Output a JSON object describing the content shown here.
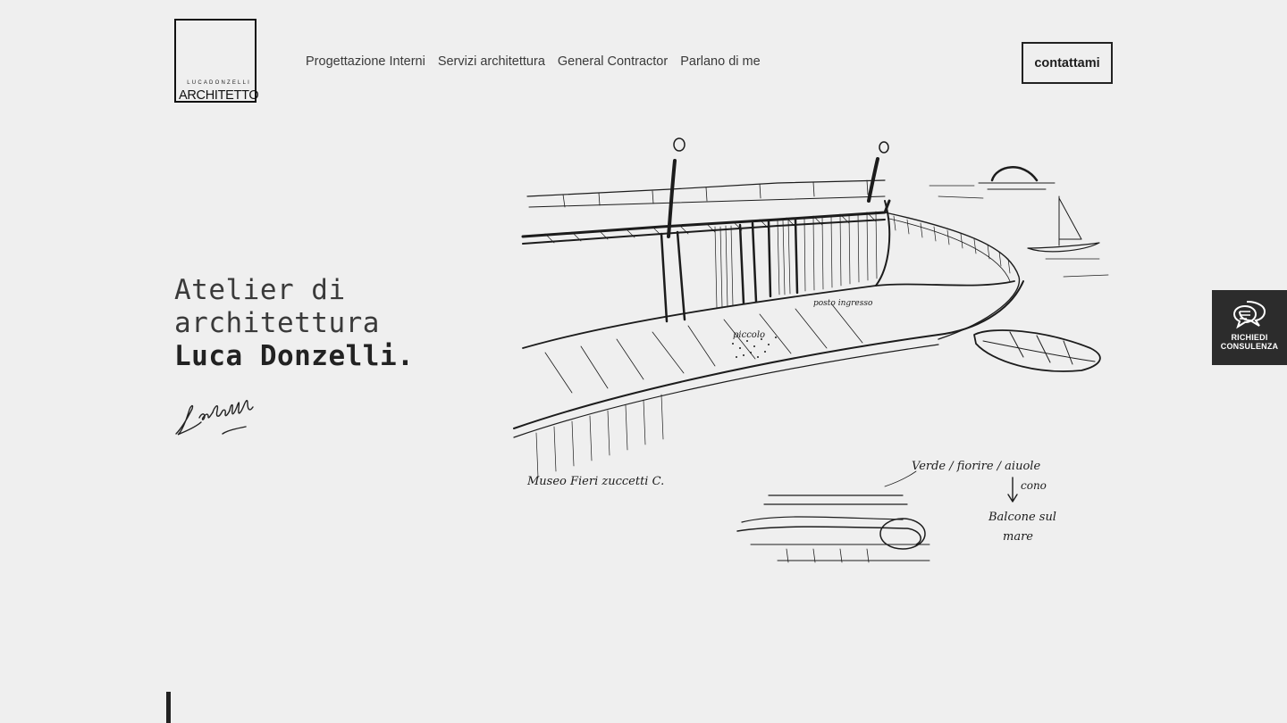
{
  "logo": {
    "small_text": "LUCADONZELLI",
    "big_text": "ARCHITETTO"
  },
  "nav": {
    "items": [
      {
        "label": "Progettazione Interni"
      },
      {
        "label": "Servizi architettura"
      },
      {
        "label": "General Contractor"
      },
      {
        "label": "Parlano di me"
      }
    ]
  },
  "cta": {
    "label": "contattami"
  },
  "hero": {
    "line1": "Atelier di",
    "line2": "architettura",
    "line3": "Luca Donzelli."
  },
  "sketch": {
    "annotation_left": "Museo Fieri  zuccetti C.",
    "annotation_right_1": "Verde / fiorire / aiuole",
    "annotation_right_2": "cono",
    "annotation_right_3": "Balcone sul",
    "annotation_right_4": "mare",
    "annotation_mid": "piccolo",
    "annotation_mid2": "posto ingresso"
  },
  "consult": {
    "line1": "RICHIEDI",
    "line2": "CONSULENZA"
  }
}
